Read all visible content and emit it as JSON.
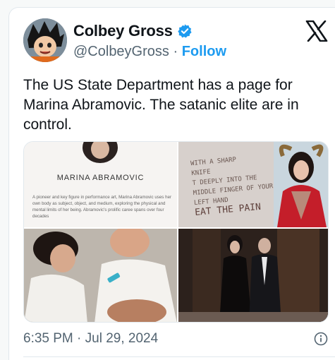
{
  "author": {
    "name": "Colbey Gross",
    "handle": "@ColbeyGross",
    "separator": "·",
    "follow_label": "Follow",
    "avatar_icon": "cartoon-avatar-icon",
    "verified_icon": "verified-badge-icon"
  },
  "tweet": {
    "text": "The US State Department  has a page for Marina Abramovic. The satanic  elite are in control."
  },
  "media": {
    "tile1": {
      "title": "MARINA ABRAMOVIC",
      "body": "A pioneer and key figure in performance art, Marina Abramovic uses her own body as subject, object, and medium, exploring the physical and mental limits of her being. Abramovic's prolific caree spans over four decades"
    },
    "tile2": {
      "lines": [
        "WITH A SHARP",
        "KNIFE",
        "T DEEPLY INTO THE",
        "MIDDLE FINGER OF YOUR",
        "LEFT HAND",
        "EAT THE PAIN"
      ]
    }
  },
  "footer": {
    "timestamp": "6:35 PM · Jul 29, 2024",
    "info_icon": "info-icon"
  },
  "colors": {
    "accent": "#1d9bf0",
    "text": "#0f1419",
    "muted": "#536471"
  }
}
